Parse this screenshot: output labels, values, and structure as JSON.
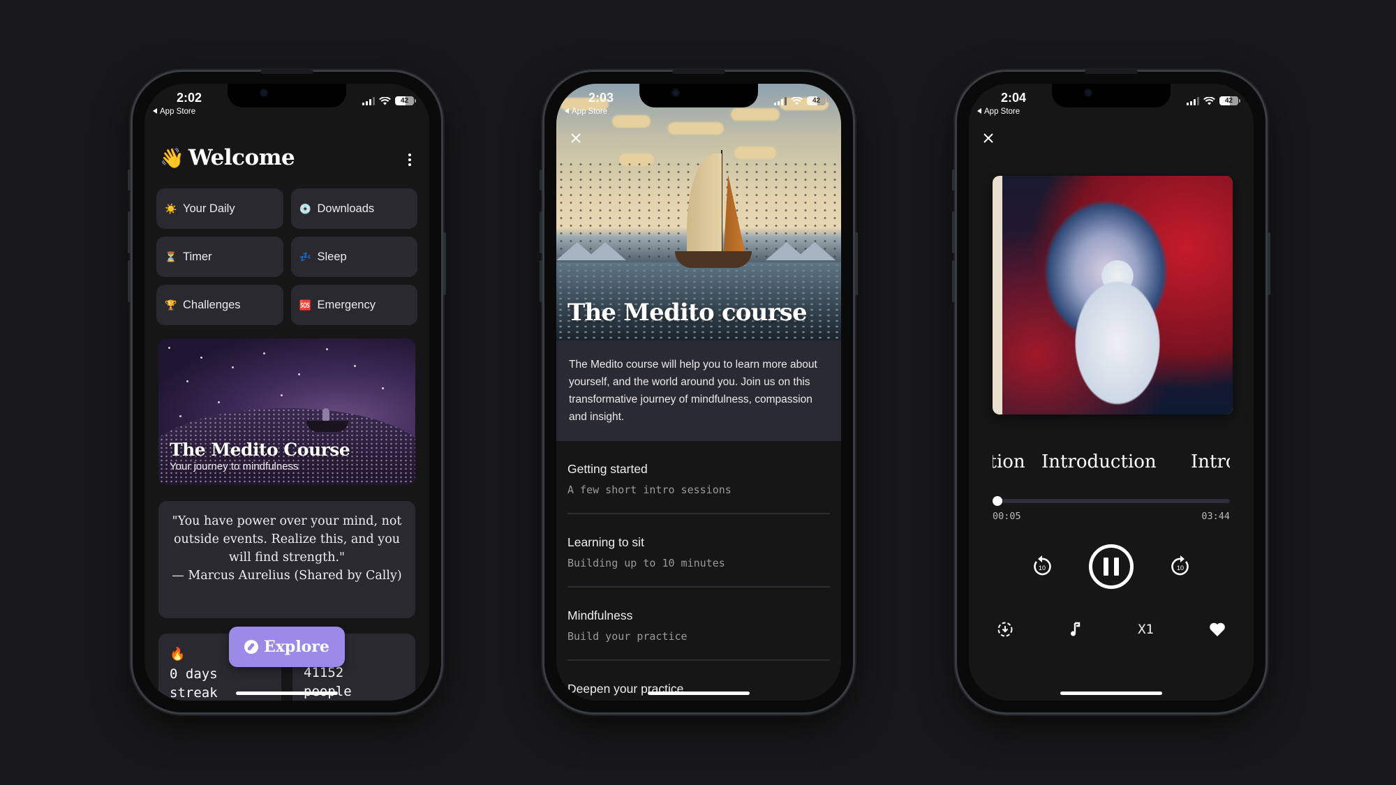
{
  "screens": [
    {
      "status": {
        "time": "2:02",
        "back_label": "App Store",
        "battery": "42"
      },
      "header": {
        "emoji": "👋",
        "title": "Welcome"
      },
      "shortcuts": [
        {
          "icon": "☀️",
          "icon_name": "sun-icon",
          "label": "Your Daily"
        },
        {
          "icon": "💿",
          "icon_name": "disc-icon",
          "label": "Downloads"
        },
        {
          "icon": "⏳",
          "icon_name": "hourglass-icon",
          "label": "Timer"
        },
        {
          "icon": "💤",
          "icon_name": "zzz-icon",
          "label": "Sleep"
        },
        {
          "icon": "🏆",
          "icon_name": "trophy-icon",
          "label": "Challenges"
        },
        {
          "icon": "🆘",
          "icon_name": "sos-icon",
          "label": "Emergency"
        }
      ],
      "featured": {
        "title": "The Medito Course",
        "subtitle": "Your journey to mindfulness"
      },
      "quote": {
        "text": "\"You have power over your mind, not outside events. Realize this, and you will find strength.\"",
        "author": "— Marcus Aurelius (Shared by Cally)"
      },
      "stats": [
        {
          "icon": "🔥",
          "value": "0 days",
          "label": "streak"
        },
        {
          "value": "41152",
          "label": "people"
        }
      ],
      "explore_button": {
        "label": "Explore",
        "color": "#9b8ae8"
      }
    },
    {
      "status": {
        "time": "2:03",
        "back_label": "App Store",
        "battery": "42"
      },
      "hero": {
        "title": "The Medito course",
        "close_icon": "✕"
      },
      "description": "The Medito course will help you to learn more about yourself, and the world around you. Join us on this transformative journey of mindfulness, compassion and insight.",
      "sections": [
        {
          "name": "Getting started",
          "subtitle": "A few short intro sessions"
        },
        {
          "name": "Learning to sit",
          "subtitle": "Building up to 10 minutes"
        },
        {
          "name": "Mindfulness",
          "subtitle": "Build your practice"
        },
        {
          "name": "Deepen your practice",
          "subtitle": ""
        }
      ]
    },
    {
      "status": {
        "time": "2:04",
        "back_label": "App Store",
        "battery": "42"
      },
      "close_icon": "✕",
      "track_titles": {
        "prev": "Introduction",
        "current": "Introduction",
        "next": "Introduction"
      },
      "player": {
        "elapsed": "00:05",
        "duration": "03:44",
        "progress": 0.022,
        "skip_seconds": "10",
        "speed": "X1"
      }
    }
  ]
}
